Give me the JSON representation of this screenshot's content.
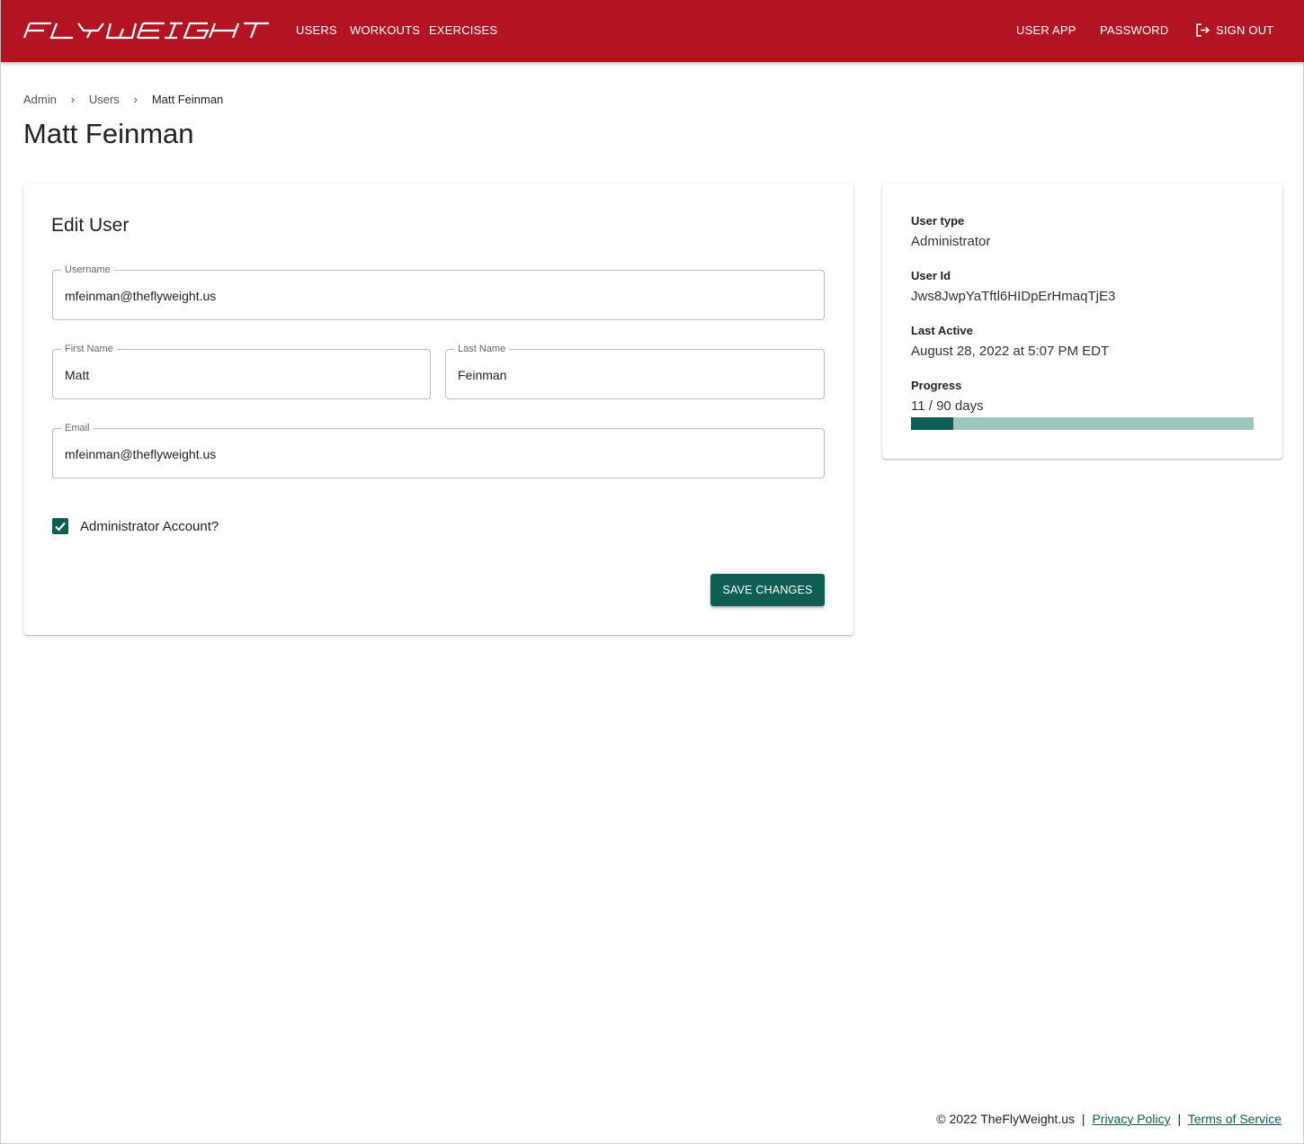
{
  "header": {
    "logo_text": "FLYWEIGHT",
    "nav_left": [
      "USERS",
      "WORKOUTS",
      "EXERCISES"
    ],
    "nav_right": {
      "user_app": "USER APP",
      "password": "PASSWORD",
      "sign_out": "SIGN OUT"
    },
    "colors": {
      "bar": "#b21521",
      "accent": "#0e5e54"
    }
  },
  "breadcrumb": [
    "Admin",
    "Users",
    "Matt Feinman"
  ],
  "page_title": "Matt Feinman",
  "edit_user": {
    "title": "Edit User",
    "username": {
      "label": "Username",
      "value": "mfeinman@theflyweight.us"
    },
    "first_name": {
      "label": "First Name",
      "value": "Matt"
    },
    "last_name": {
      "label": "Last Name",
      "value": "Feinman"
    },
    "email": {
      "label": "Email",
      "value": "mfeinman@theflyweight.us"
    },
    "admin_checkbox": {
      "label": "Administrator Account?",
      "checked": true
    },
    "save_label": "SAVE CHANGES"
  },
  "user_info": {
    "user_type_label": "User type",
    "user_type": "Administrator",
    "user_id_label": "User Id",
    "user_id": "Jws8JwpYaTftl6HIDpErHmaqTjE3",
    "last_active_label": "Last Active",
    "last_active": "August 28, 2022 at 5:07 PM EDT",
    "progress_label": "Progress",
    "progress_text": "11 / 90 days",
    "progress_done": 11,
    "progress_total": 90
  },
  "footer": {
    "copyright": "© 2022 TheFlyWeight.us",
    "privacy": "Privacy Policy",
    "terms": "Terms of Service",
    "separator": "|"
  }
}
